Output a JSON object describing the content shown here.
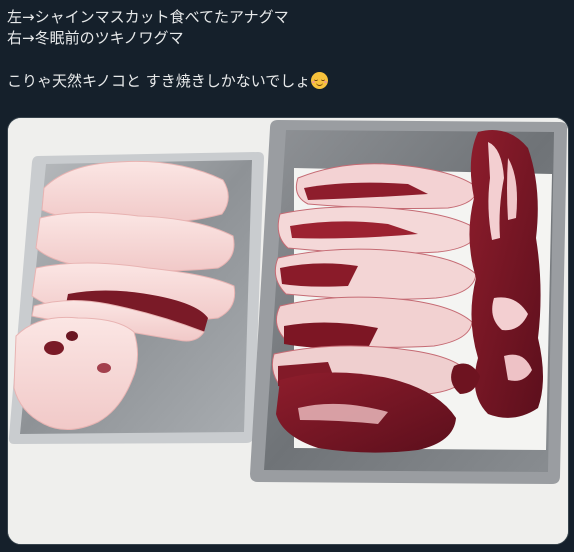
{
  "tweet": {
    "lines": [
      "左→シャインマスカット食べてたアナグマ",
      "右→冬眠前のツキノワグマ",
      "",
      "こりゃ天然キノコと すき焼きしかないでしょ"
    ],
    "emoji": "relieved-face-emoji"
  },
  "photo": {
    "subject": "two metal trays of raw meat on a white table",
    "left_tray": "badger meat, mostly white fat",
    "right_tray": "bear meat, red with fat layers"
  }
}
